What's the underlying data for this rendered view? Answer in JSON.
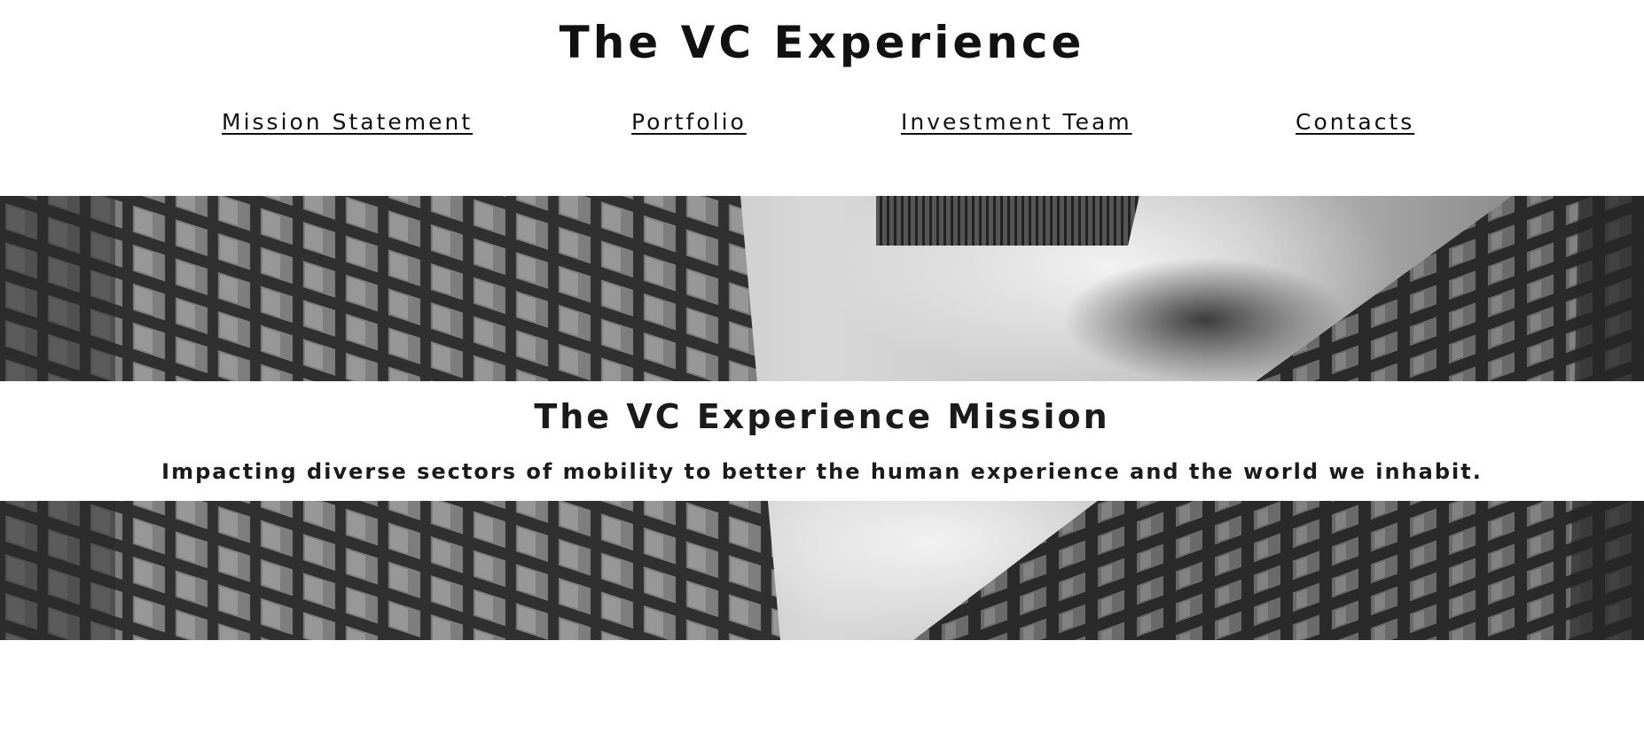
{
  "header": {
    "title": "The VC Experience"
  },
  "nav": {
    "items": [
      {
        "label": "Mission Statement"
      },
      {
        "label": "Portfolio"
      },
      {
        "label": "Investment Team"
      },
      {
        "label": "Contacts"
      }
    ]
  },
  "hero": {
    "image": "black-and-white skyscrapers looking up at cloudy sky"
  },
  "mission": {
    "title": "The VC Experience Mission",
    "subtitle": "Impacting diverse sectors of mobility to better the human experience and the world we inhabit."
  }
}
